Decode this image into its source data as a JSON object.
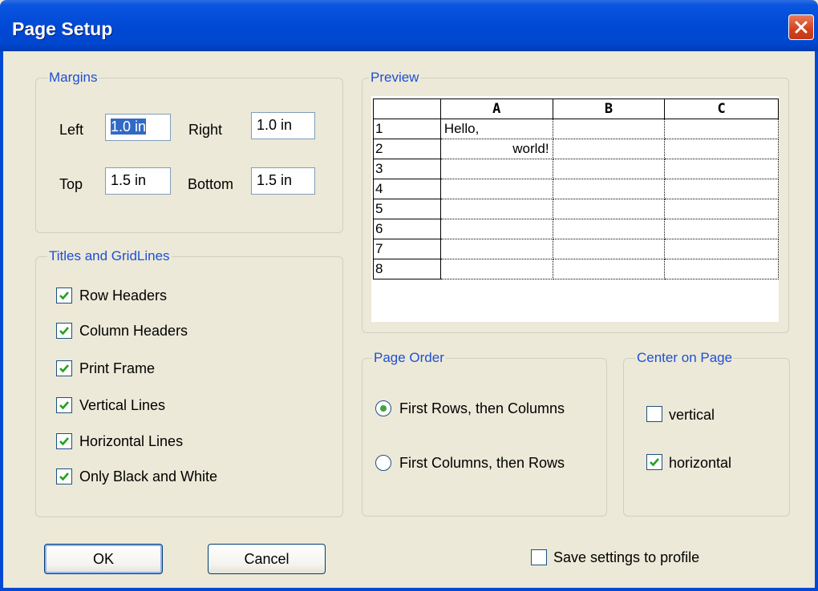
{
  "window": {
    "title": "Page Setup"
  },
  "margins": {
    "legend": "Margins",
    "left_label": "Left",
    "left_value": "1.0 in",
    "right_label": "Right",
    "right_value": "1.0 in",
    "top_label": "Top",
    "top_value": "1.5 in",
    "bottom_label": "Bottom",
    "bottom_value": "1.5 in"
  },
  "titles": {
    "legend": "Titles and GridLines",
    "options": [
      {
        "label": "Row Headers",
        "checked": true
      },
      {
        "label": "Column Headers",
        "checked": true
      },
      {
        "label": "Print Frame",
        "checked": true
      },
      {
        "label": "Vertical Lines",
        "checked": true
      },
      {
        "label": "Horizontal Lines",
        "checked": true
      },
      {
        "label": "Only Black and White",
        "checked": true
      }
    ]
  },
  "preview": {
    "legend": "Preview",
    "columns": [
      "A",
      "B",
      "C"
    ],
    "rows": [
      "1",
      "2",
      "3",
      "4",
      "5",
      "6",
      "7",
      "8"
    ],
    "cell_a1": "Hello,",
    "cell_a2": "world!"
  },
  "page_order": {
    "legend": "Page Order",
    "options": [
      {
        "label": "First Rows, then Columns",
        "selected": true
      },
      {
        "label": "First Columns, then Rows",
        "selected": false
      }
    ]
  },
  "center": {
    "legend": "Center on Page",
    "options": [
      {
        "label": "vertical",
        "checked": false
      },
      {
        "label": "horizontal",
        "checked": true
      }
    ]
  },
  "buttons": {
    "ok": "OK",
    "cancel": "Cancel"
  },
  "save_profile": {
    "label": "Save settings to profile",
    "checked": false
  }
}
